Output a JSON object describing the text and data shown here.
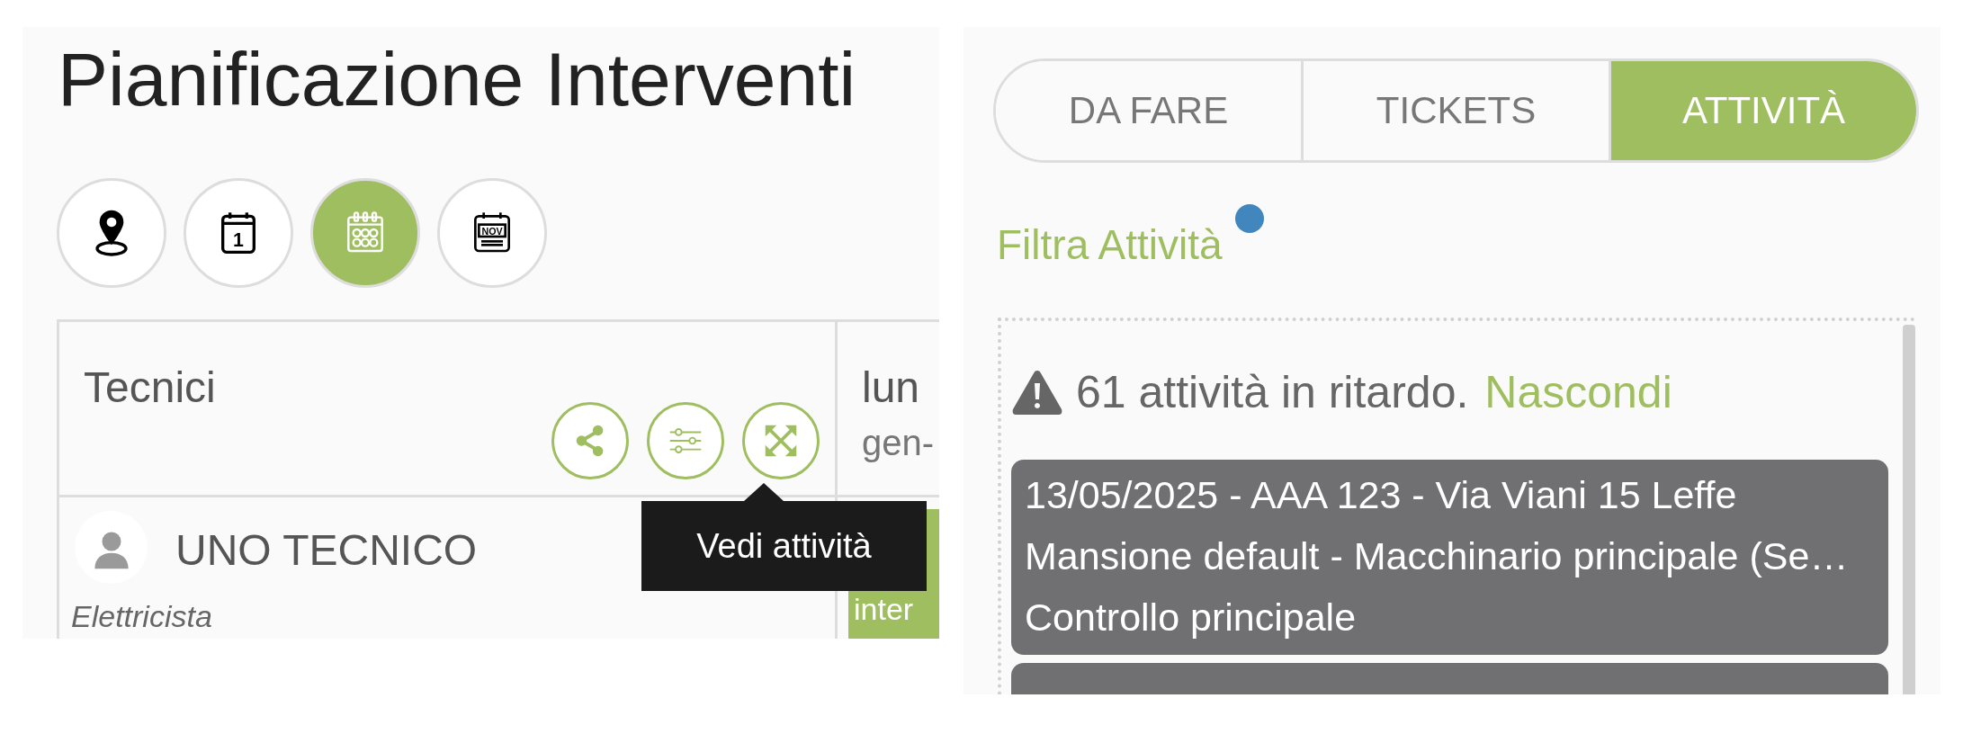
{
  "title": "Pianificazione Interventi",
  "view_buttons": [
    {
      "kind": "map",
      "selected": false
    },
    {
      "kind": "day",
      "icon_text": "1",
      "selected": false
    },
    {
      "kind": "month_grid",
      "selected": true
    },
    {
      "kind": "month",
      "icon_text": "NOV",
      "selected": false
    }
  ],
  "planner": {
    "columns": [
      {
        "label": "Tecnici"
      },
      {
        "label": "lun",
        "sublabel": "gen-"
      }
    ],
    "header_actions": [
      {
        "kind": "share"
      },
      {
        "kind": "filters"
      },
      {
        "kind": "expand",
        "tooltip": "Vedi attività"
      }
    ],
    "rows": [
      {
        "name": "UNO TECNICO",
        "role": "Elettricista",
        "events": [
          {
            "text": "inter"
          }
        ]
      }
    ]
  },
  "tabs": [
    {
      "label": "DA FARE",
      "selected": false
    },
    {
      "label": "TICKETS",
      "selected": false
    },
    {
      "label": "ATTIVITÀ",
      "selected": true
    }
  ],
  "filter": {
    "label": "Filtra Attività",
    "indicator": true
  },
  "alert": {
    "text": "61 attività in ritardo.",
    "link": "Nascondi"
  },
  "activities": [
    {
      "kind": "overdue",
      "lines": [
        "13/05/2025 - AAA 123 - Via Viani 15 Leffe",
        "Mansione default - Macchinario principale (Se…",
        "Controllo principale"
      ]
    },
    {
      "kind": "overdue"
    }
  ]
}
